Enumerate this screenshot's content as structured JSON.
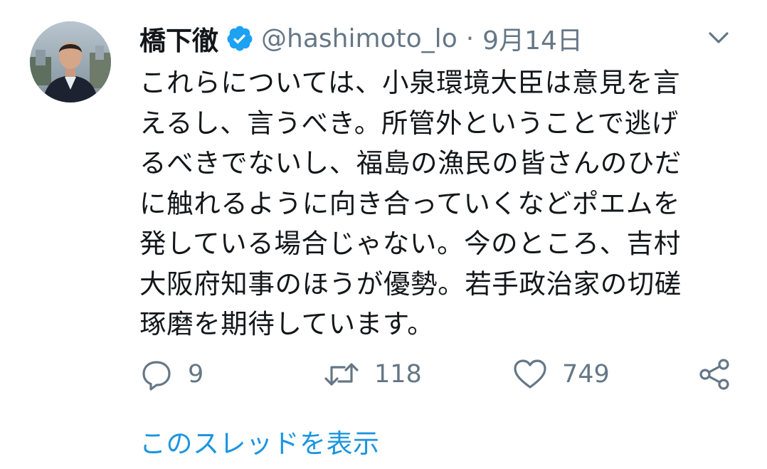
{
  "author": {
    "name": "橋下徹",
    "handle": "@hashimoto_lo",
    "separator": "·",
    "date": "9月14日"
  },
  "tweet": {
    "lines": [
      "これらについては、小泉環境大臣は意見を言",
      "えるし、言うべき。所管外ということで逃げ",
      "るべきでないし、福島の漁民の皆さんのひだ",
      "に触れるように向き合っていくなどポエムを",
      "発している場合じゃない。今のところ、吉村",
      "大阪府知事のほうが優勢。若手政治家の切磋",
      "琢磨を期待しています。"
    ]
  },
  "actions": {
    "replies": "9",
    "retweets": "118",
    "likes": "749"
  },
  "thread_link": "このスレッドを表示",
  "icons": {
    "verified": "verified-badge-icon",
    "menu": "chevron-down-icon",
    "reply": "reply-icon",
    "retweet": "retweet-icon",
    "like": "heart-icon",
    "share": "share-icon"
  },
  "colors": {
    "accent": "#1b95e0",
    "muted": "#657786",
    "text": "#14171a"
  }
}
